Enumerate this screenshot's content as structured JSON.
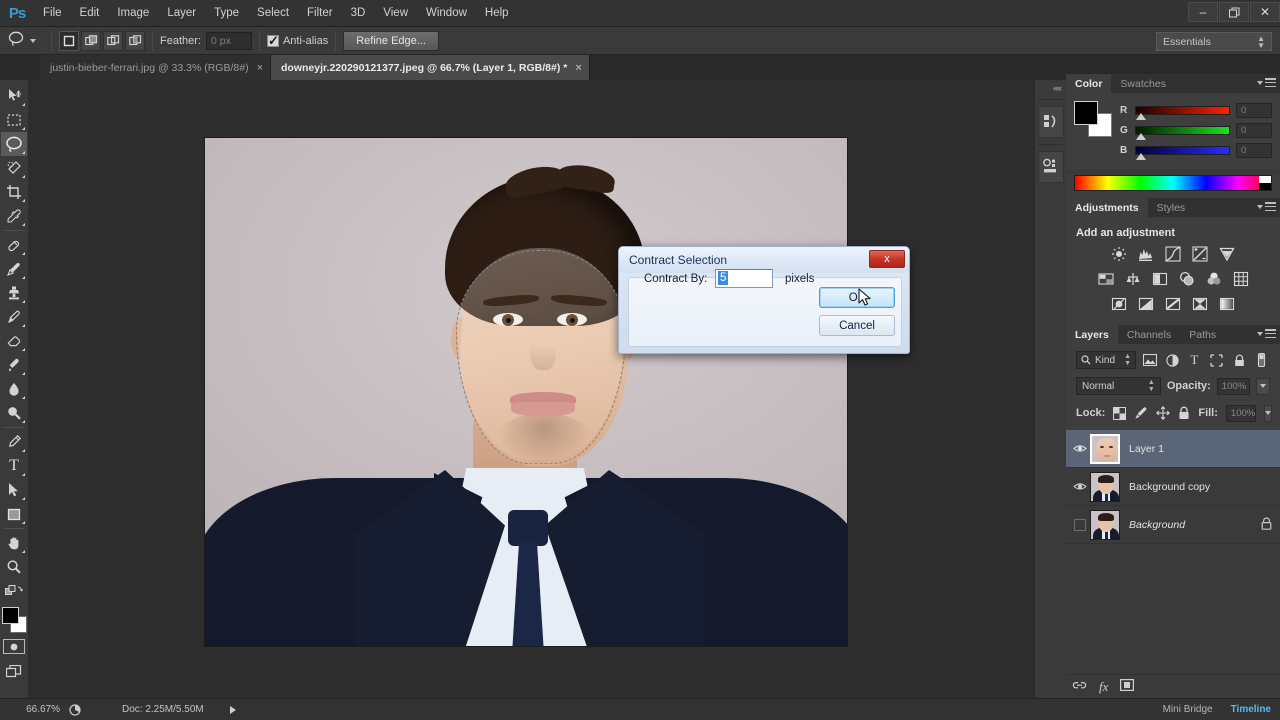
{
  "app": {
    "name": "Ps",
    "workspace": "Essentials"
  },
  "menubar": {
    "items": [
      "File",
      "Edit",
      "Image",
      "Layer",
      "Type",
      "Select",
      "Filter",
      "3D",
      "View",
      "Window",
      "Help"
    ]
  },
  "window_controls": {
    "minimize": "–",
    "restore": "❐",
    "close": "✕"
  },
  "optionsbar": {
    "tool_icon": "lasso-icon",
    "selection_modes": [
      "new-selection",
      "add-to-selection",
      "subtract-from-selection",
      "intersect-with-selection"
    ],
    "feather_label": "Feather:",
    "feather_value": "0 px",
    "antialias_label": "Anti-alias",
    "antialias_checked": true,
    "refine_edge_label": "Refine Edge..."
  },
  "tabs": [
    {
      "label": "justin-bieber-ferrari.jpg @ 33.3% (RGB/8#)",
      "active": false,
      "close": "×"
    },
    {
      "label": "downeyjr.220290121377.jpeg @ 66.7% (Layer 1, RGB/8#) *",
      "active": true,
      "close": "×"
    }
  ],
  "toolbar": {
    "tools": [
      {
        "name": "move-tool",
        "active": false
      },
      {
        "name": "rectangular-marquee-tool",
        "active": false
      },
      {
        "name": "lasso-tool",
        "active": true
      },
      {
        "name": "quick-selection-tool",
        "active": false
      },
      {
        "name": "crop-tool",
        "active": false
      },
      {
        "name": "eyedropper-tool",
        "active": false
      },
      {
        "name": "spot-healing-brush-tool",
        "active": false
      },
      {
        "name": "brush-tool",
        "active": false
      },
      {
        "name": "clone-stamp-tool",
        "active": false
      },
      {
        "name": "history-brush-tool",
        "active": false
      },
      {
        "name": "eraser-tool",
        "active": false
      },
      {
        "name": "gradient-tool",
        "active": false
      },
      {
        "name": "blur-tool",
        "active": false
      },
      {
        "name": "dodge-tool",
        "active": false
      },
      {
        "name": "pen-tool",
        "active": false
      },
      {
        "name": "type-tool",
        "active": false
      },
      {
        "name": "path-selection-tool",
        "active": false
      },
      {
        "name": "rectangle-tool",
        "active": false
      },
      {
        "name": "hand-tool",
        "active": false
      },
      {
        "name": "zoom-tool",
        "active": false
      }
    ],
    "foreground_color": "#000000",
    "background_color": "#ffffff",
    "type_glyph": "T"
  },
  "panels": {
    "color": {
      "tabs": [
        {
          "label": "Color",
          "active": true
        },
        {
          "label": "Swatches",
          "active": false
        }
      ],
      "channels": [
        {
          "label": "R",
          "value": "0"
        },
        {
          "label": "G",
          "value": "0"
        },
        {
          "label": "B",
          "value": "0"
        }
      ]
    },
    "adjustments": {
      "tabs": [
        {
          "label": "Adjustments",
          "active": true
        },
        {
          "label": "Styles",
          "active": false
        }
      ],
      "title": "Add an adjustment",
      "row1": [
        "brightness-contrast-icon",
        "levels-icon",
        "curves-icon",
        "exposure-icon",
        "vibrance-icon"
      ],
      "row2": [
        "hue-saturation-icon",
        "color-balance-icon",
        "black-white-icon",
        "photo-filter-icon",
        "channel-mixer-icon",
        "color-lookup-icon"
      ],
      "row3": [
        "invert-icon",
        "posterize-icon",
        "threshold-icon",
        "selective-color-icon",
        "gradient-map-icon"
      ]
    },
    "layers": {
      "tabs": [
        {
          "label": "Layers",
          "active": true
        },
        {
          "label": "Channels",
          "active": false
        },
        {
          "label": "Paths",
          "active": false
        }
      ],
      "filter_label": "Kind",
      "filter_icons": [
        "pixel-layers-icon",
        "adjustment-layers-icon",
        "type-layers-icon",
        "shape-layers-icon",
        "smart-objects-icon",
        "filter-toggle-icon"
      ],
      "blend_mode": "Normal",
      "opacity_label": "Opacity:",
      "opacity_value": "100%",
      "lock_label": "Lock:",
      "lock_icons": [
        "lock-transparent-pixels-icon",
        "lock-image-pixels-icon",
        "lock-position-icon",
        "lock-all-icon"
      ],
      "fill_label": "Fill:",
      "fill_value": "100%",
      "rows": [
        {
          "name": "Layer 1",
          "visible": true,
          "selected": true,
          "locked": false,
          "italic": false,
          "thumb": "face"
        },
        {
          "name": "Background copy",
          "visible": true,
          "selected": false,
          "locked": false,
          "italic": false,
          "thumb": "portrait"
        },
        {
          "name": "Background",
          "visible": false,
          "selected": false,
          "locked": true,
          "italic": true,
          "thumb": "portrait"
        }
      ],
      "footer_icons": [
        "link-layers-icon",
        "fx-icon",
        "add-layer-mask-icon"
      ],
      "fx_label": "fx"
    },
    "dock": {
      "buttons": [
        "mini-bridge-icon",
        "histogram-icon"
      ],
      "collapse": "««"
    }
  },
  "dialog": {
    "title": "Contract Selection",
    "close": "x",
    "field_label": "Contract By:",
    "field_value": "5",
    "units": "pixels",
    "ok_label": "OK",
    "cancel_label": "Cancel",
    "accent_blue": "#3b8ede",
    "close_red": "#c8362a"
  },
  "statusbar": {
    "zoom": "66.67%",
    "doc_info": "Doc: 2.25M/5.50M",
    "bottom_tabs": [
      {
        "label": "Mini Bridge",
        "active": false
      },
      {
        "label": "Timeline",
        "active": true
      }
    ]
  }
}
